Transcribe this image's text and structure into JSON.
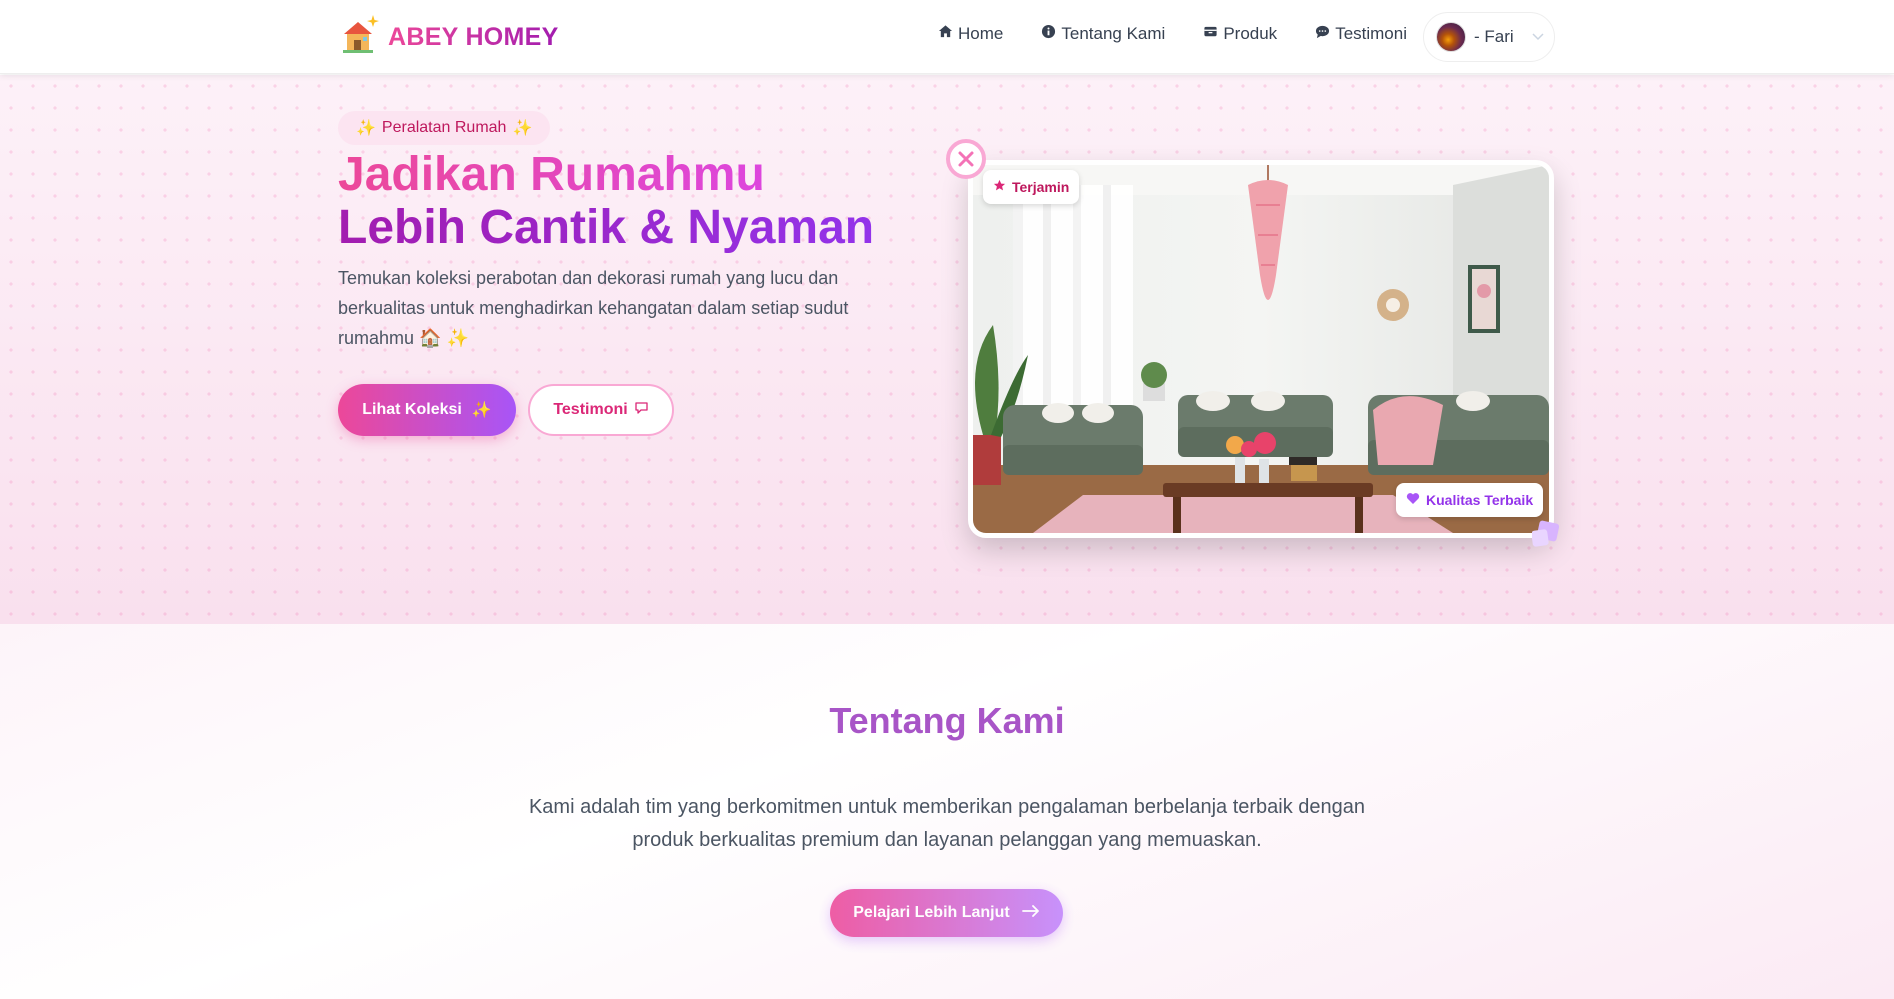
{
  "brand": {
    "name": "ABEY HOMEY",
    "logo_icon": "house-sparkle-icon"
  },
  "nav": {
    "items": [
      {
        "label": "Home",
        "icon": "home-icon"
      },
      {
        "label": "Tentang Kami",
        "icon": "info-icon"
      },
      {
        "label": "Produk",
        "icon": "box-icon"
      },
      {
        "label": "Testimoni",
        "icon": "chat-icon"
      }
    ],
    "user": {
      "name": "- Fari"
    }
  },
  "hero": {
    "badge": "Peralatan Rumah",
    "title_line1": "Jadikan Rumahmu",
    "title_line2": "Lebih Cantik & Nyaman",
    "description": "Temukan koleksi perabotan dan dekorasi rumah yang lucu dan berkualitas untuk menghadirkan kehangatan dalam setiap sudut rumahmu",
    "primary_button": "Lihat Koleksi",
    "secondary_button": "Testimoni",
    "tag_guarantee": "Terjamin",
    "tag_quality": "Kualitas Terbaik"
  },
  "about": {
    "title": "Tentang Kami",
    "text": "Kami adalah tim yang berkomitmen untuk memberikan pengalaman berbelanja terbaik dengan produk berkualitas premium dan layanan pelanggan yang memuaskan.",
    "button": "Pelajari Lebih Lanjut"
  },
  "colors": {
    "primary_pink": "#ec4899",
    "primary_purple": "#a855f7",
    "hero_bg": "#fbeaf4"
  }
}
